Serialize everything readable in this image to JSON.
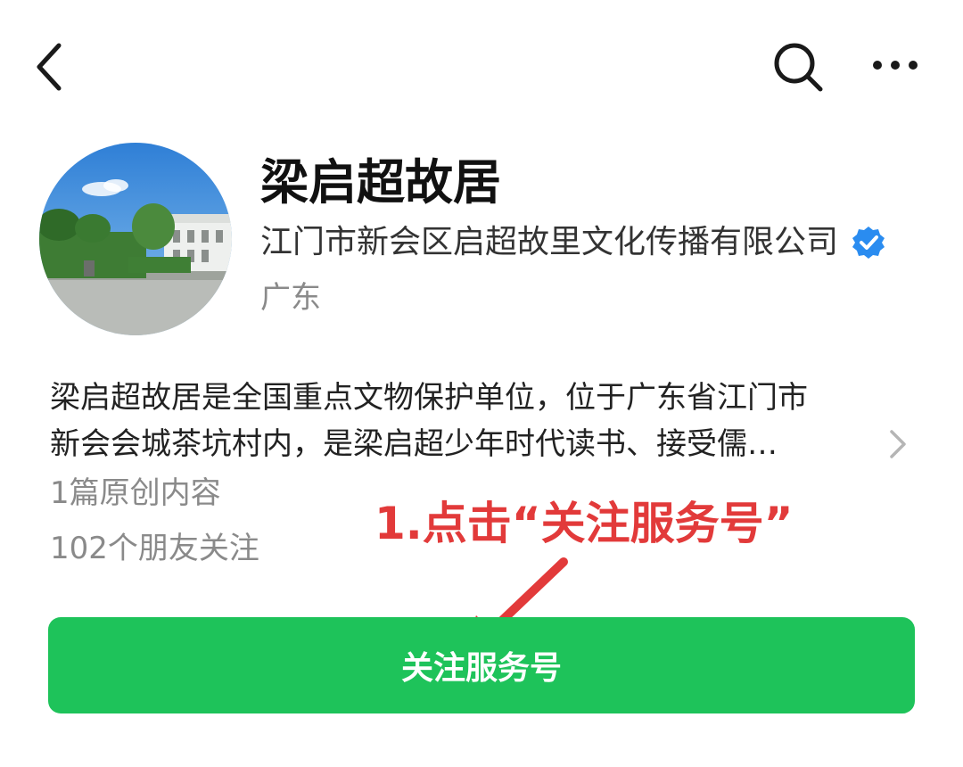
{
  "header": {
    "back_icon": "chevron-left-icon",
    "search_icon": "search-icon",
    "more_icon": "more-horizontal-icon"
  },
  "profile": {
    "name": "梁启超故居",
    "company": "江门市新会区启超故里文化传播有限公司",
    "verified_icon": "verified-badge-icon",
    "verified_color": "#2a8cf0",
    "region": "广东"
  },
  "description": {
    "line1": "梁启超故居是全国重点文物保护单位，位于广东省江门市",
    "line2": "新会会城茶坑村内，是梁启超少年时代读书、接受儒…",
    "chevron_icon": "chevron-right-icon"
  },
  "stats": {
    "articles": "1篇原创内容",
    "friends": "102个朋友关注"
  },
  "annotation": {
    "text": "1.点击“关注服务号”",
    "color": "#e23a3a"
  },
  "follow_button": {
    "label": "关注服务号",
    "color": "#1ec35a"
  }
}
